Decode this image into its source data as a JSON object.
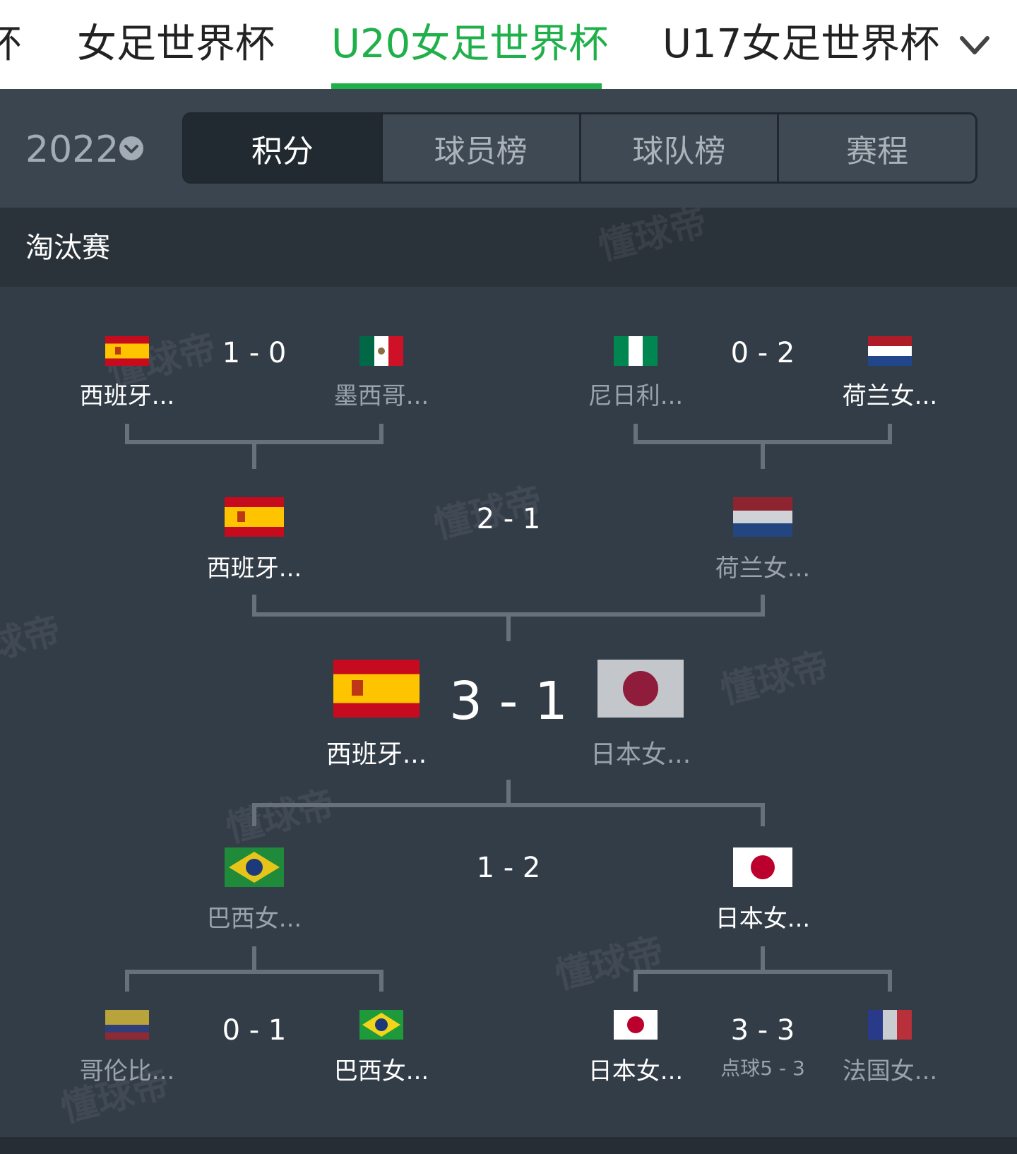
{
  "top_tabs": [
    {
      "label": "杯"
    },
    {
      "label": "女足世界杯"
    },
    {
      "label": "U20女足世界杯"
    },
    {
      "label": "U17女足世界杯"
    }
  ],
  "season": {
    "year": "2022"
  },
  "segments": [
    "积分",
    "球员榜",
    "球队榜",
    "赛程"
  ],
  "section": {
    "title": "淘汰赛"
  },
  "watermark": "懂球帝",
  "bracket": {
    "qf_left_top": {
      "home": "西班牙...",
      "away": "墨西哥...",
      "score": "1 - 0"
    },
    "qf_right_top": {
      "home": "尼日利...",
      "away": "荷兰女...",
      "score": "0 - 2"
    },
    "sf_top": {
      "home": "西班牙...",
      "away": "荷兰女...",
      "score": "2 - 1"
    },
    "final": {
      "home": "西班牙...",
      "away": "日本女...",
      "score": "3 - 1"
    },
    "sf_bottom": {
      "home": "巴西女...",
      "away": "日本女...",
      "score": "1 - 2"
    },
    "qf_left_bottom": {
      "home": "哥伦比...",
      "away": "巴西女...",
      "score": "0 - 1"
    },
    "qf_right_bottom": {
      "home": "日本女...",
      "away": "法国女...",
      "score": "3 - 3",
      "penalties": "点球5 - 3"
    }
  },
  "colors": {
    "accent": "#1fb04a",
    "background": "#333d47",
    "line": "#66717c"
  }
}
